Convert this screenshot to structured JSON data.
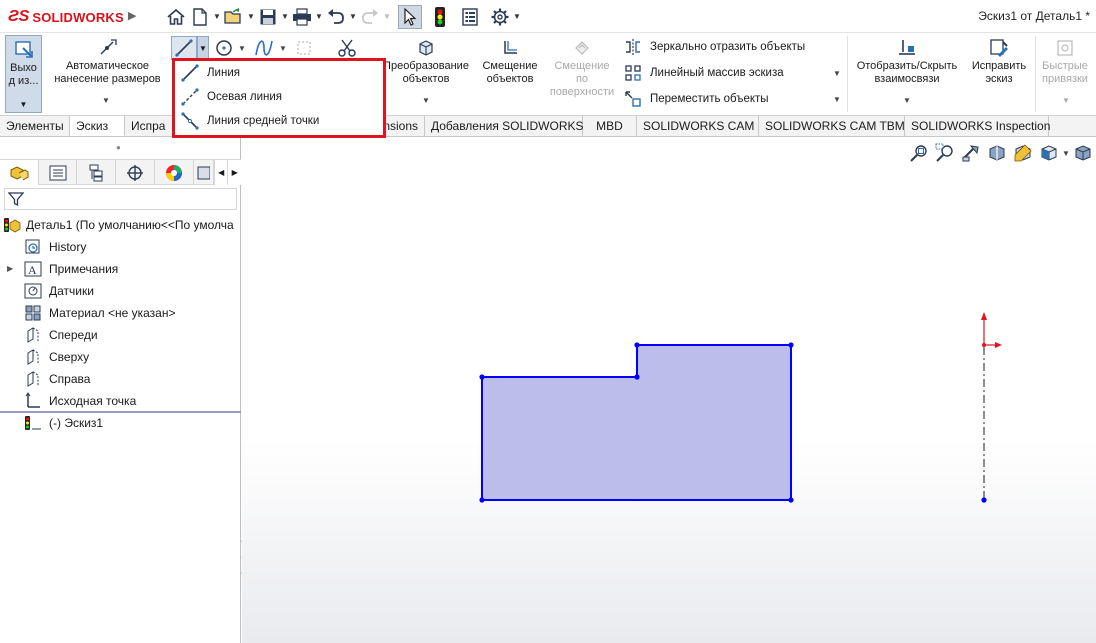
{
  "app": {
    "brand": "SOLIDWORKS",
    "doc_title": "Эскиз1 от Деталь1 *"
  },
  "quick_access": {
    "icons": [
      "home-icon",
      "new-document-icon",
      "open-icon",
      "save-icon",
      "print-icon",
      "undo-icon",
      "redo-icon",
      "select-icon",
      "rebuild-icon",
      "file-properties-icon",
      "options-icon"
    ]
  },
  "ribbon": {
    "exit_sketch": "Выхо\nд из...",
    "smart_dimension": "Автоматическое\nнанесение размеров",
    "convert_entities": "Преобразование\nобъектов",
    "offset_entities": "Смещение\nобъектов",
    "offset_on_surface": "Смещение\nпо\nповерхности",
    "mirror_entities": "Зеркально отразить объекты",
    "linear_pattern": "Линейный массив эскиза",
    "move_entities": "Переместить объекты",
    "display_relations": "Отобразить/Скрыть\nвзаимосвязи",
    "repair_sketch": "Исправить\nэскиз",
    "quick_snaps": "Быстрые\nпривязки"
  },
  "line_flyout": {
    "items": [
      "Линия",
      "Осевая линия",
      "Линия средней точки"
    ]
  },
  "tabs": [
    "Элементы",
    "Эскиз",
    "Испра",
    "nsions",
    "Добавления SOLIDWORKS",
    "MBD",
    "SOLIDWORKS CAM",
    "SOLIDWORKS CAM TBM",
    "SOLIDWORKS Inspection"
  ],
  "tree": {
    "root": "Деталь1  (По умолчанию<<По умолча",
    "items": [
      "History",
      "Примечания",
      "Датчики",
      "Материал <не указан>",
      "Спереди",
      "Сверху",
      "Справа",
      "Исходная точка",
      "(-) Эскиз1"
    ]
  },
  "colors": {
    "sketch_line": "#0000ff",
    "sketch_fill": "#b9b9ea",
    "highlight_box": "#e0141e",
    "brand_red": "#d7121b"
  }
}
